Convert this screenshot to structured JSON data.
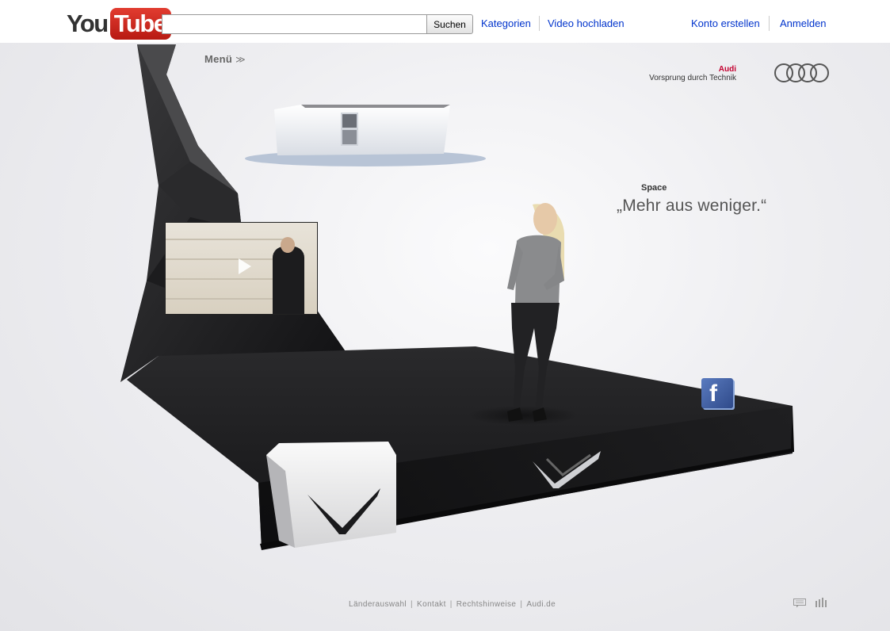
{
  "header": {
    "logo_you": "You",
    "logo_tube": "Tube",
    "search_placeholder": "",
    "search_button": "Suchen",
    "nav": [
      "Kategorien",
      "Video hochladen"
    ],
    "account": [
      "Konto erstellen",
      "Anmelden"
    ]
  },
  "stage": {
    "menu_label": "Menü",
    "menu_chevron": "≫",
    "brand": {
      "name": "Audi",
      "claim": "Vorsprung durch Technik"
    },
    "section_label": "Space",
    "quote": "„Mehr aus weniger.“"
  },
  "footer": {
    "links": [
      "Länderauswahl",
      "Kontakt",
      "Rechtshinweise",
      "Audi.de"
    ]
  },
  "icons": {
    "facebook": "facebook-icon",
    "chat": "chat-icon",
    "sound": "sound-icon",
    "play": "play-icon",
    "chevron": "chevron-down-icon"
  },
  "colors": {
    "youtube_red": "#cc181e",
    "link_blue": "#0033cc",
    "audi_red": "#c3002f",
    "platform_black": "#1a1a1c"
  }
}
